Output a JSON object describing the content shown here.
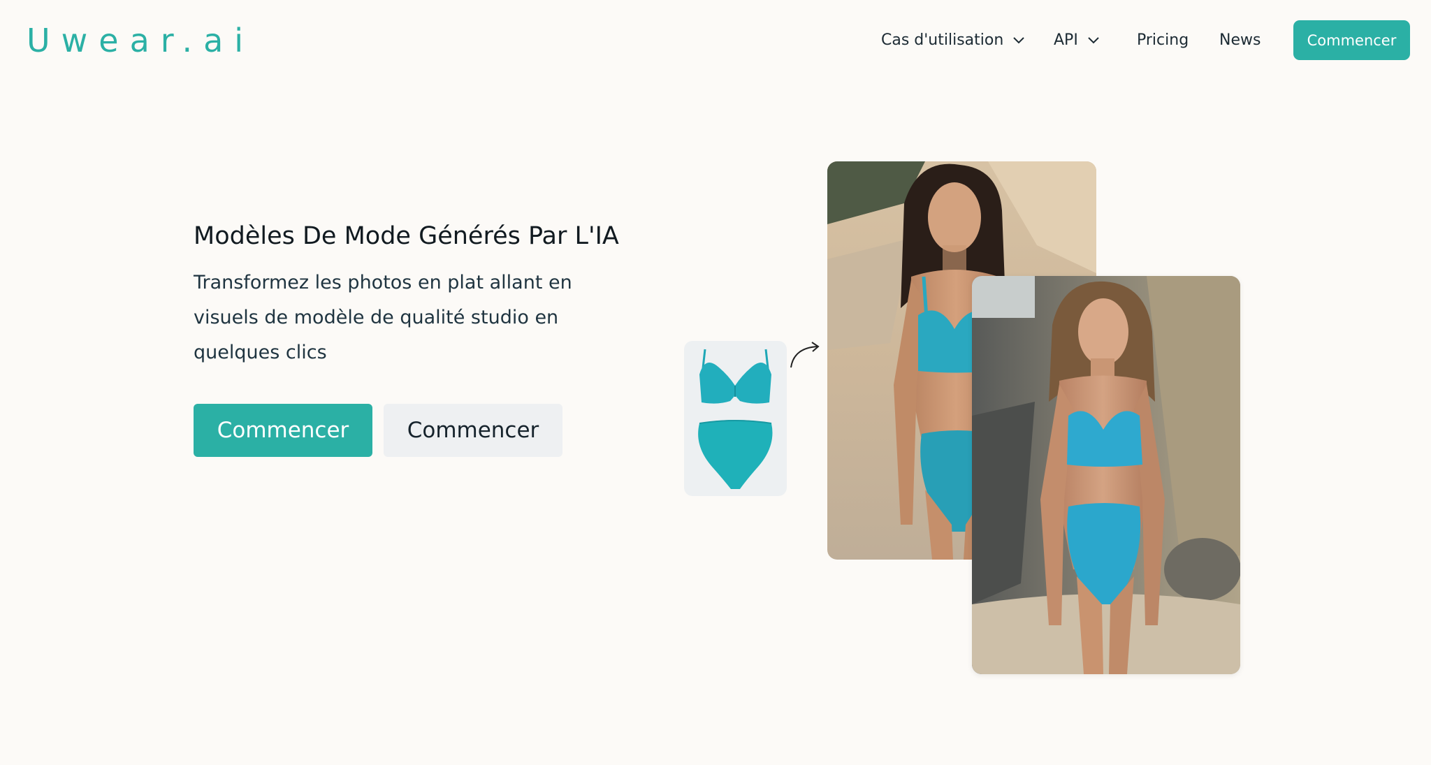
{
  "brand": {
    "logo_text": "Uwear.ai"
  },
  "nav": {
    "items": [
      {
        "label": "Cas d'utilisation",
        "has_dropdown": true
      },
      {
        "label": "API",
        "has_dropdown": true
      },
      {
        "label": "Pricing",
        "has_dropdown": false
      },
      {
        "label": "News",
        "has_dropdown": false
      }
    ],
    "cta_label": "Commencer"
  },
  "hero": {
    "title": "Modèles De Mode Générés Par L'IA",
    "subtitle": "Transformez les photos en plat allant en visuels de modèle de qualité studio en quelques clics",
    "primary_button": "Commencer",
    "secondary_button": "Commencer"
  },
  "illustration": {
    "garment_icon": "bikini-flatlay-image",
    "arrow_icon": "curved-arrow-icon",
    "photos": [
      "model-photo-beach-sand",
      "model-photo-beach-rocks"
    ]
  },
  "colors": {
    "accent": "#2bb0a5",
    "background": "#fcfaf7",
    "secondary_button": "#eef0f2",
    "swimsuit": "#2aa8c0"
  }
}
